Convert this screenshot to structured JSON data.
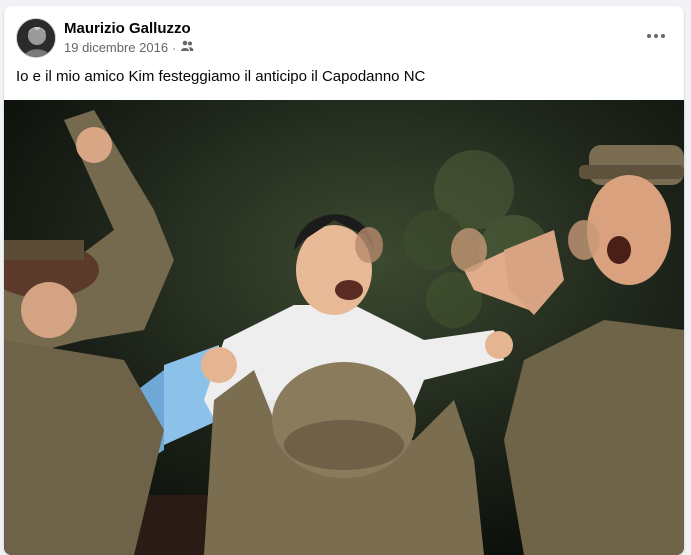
{
  "post": {
    "author": "Maurizio Galluzzo",
    "date": "19 dicembre 2016",
    "separator": "·",
    "audience_icon": "friends-icon",
    "more_icon": "more-options-icon",
    "text": "Io e il mio amico Kim festeggiamo il anticipo il Capodanno NC"
  }
}
